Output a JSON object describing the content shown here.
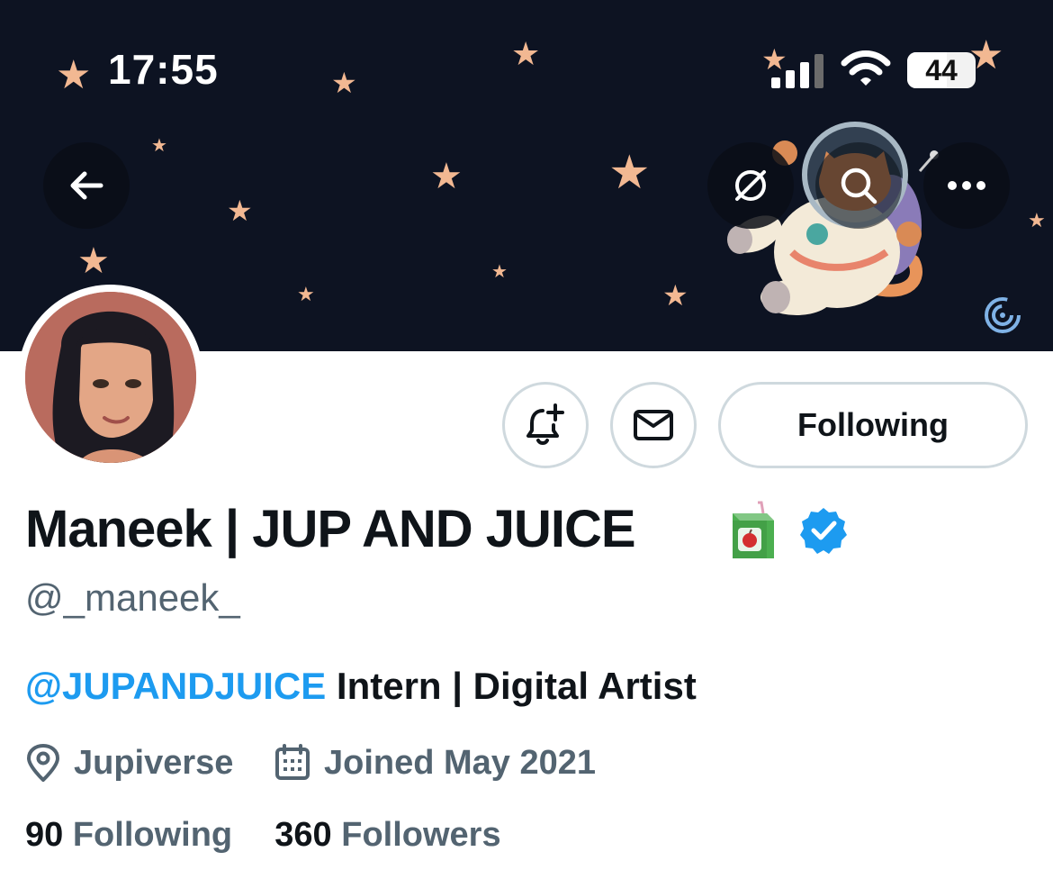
{
  "status_bar": {
    "time": "17:55",
    "battery": "44"
  },
  "banner_buttons": {
    "back": "arrow-left-icon",
    "grok": "grok-icon",
    "search": "search-icon",
    "more": "more-icon"
  },
  "actions": {
    "notify_icon": "bell-plus-icon",
    "message_icon": "mail-icon",
    "follow_label": "Following"
  },
  "profile": {
    "display_name": "Maneek | JUP AND JUICE",
    "handle": "@_maneek_",
    "bio_mention": "@JUPANDJUICE",
    "bio_text": " Intern | Digital Artist",
    "location": "Jupiverse",
    "joined": "Joined May 2021",
    "following_count": "90",
    "following_label": "Following",
    "followers_count": "360",
    "followers_label": "Followers"
  },
  "colors": {
    "banner": "#0d1322",
    "star": "#f2b892",
    "accent": "#1d9bf0",
    "secondary_text": "#536471",
    "border": "#cfd9de"
  }
}
